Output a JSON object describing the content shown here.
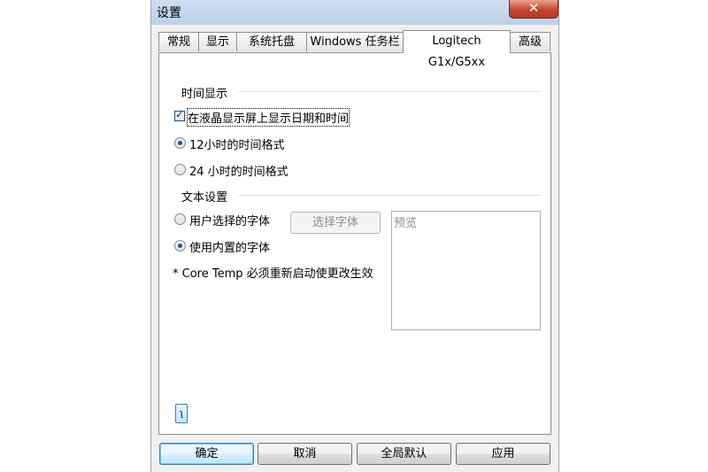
{
  "window": {
    "title": "设置",
    "close_label": "✕"
  },
  "tabs": [
    {
      "label": "常规"
    },
    {
      "label": "显示"
    },
    {
      "label": "系统托盘"
    },
    {
      "label": "Windows 任务栏"
    },
    {
      "label": "Logitech G1x/G5xx",
      "active": true
    },
    {
      "label": "高级"
    }
  ],
  "time_group": {
    "title": "时间显示",
    "show_datetime_label": "在液晶显示屏上显示日期和时间",
    "show_datetime_checked": true,
    "format_12_label": "12小时的时间格式",
    "format_24_label": "24 小时的时间格式",
    "selected_format": "12"
  },
  "text_group": {
    "title": "文本设置",
    "user_font_label": "用户选择的字体",
    "builtin_font_label": "使用内置的字体",
    "selected_font": "builtin",
    "choose_font_button": "选择字体",
    "preview_label": "预览",
    "restart_note": "* Core Temp 必须重新启动使更改生效"
  },
  "small_button_label": "͂",
  "buttons": {
    "ok": "确定",
    "cancel": "取消",
    "defaults": "全局默认",
    "apply": "应用"
  },
  "colors": {
    "accent": "#3c7fb1",
    "close": "#c7442c"
  }
}
